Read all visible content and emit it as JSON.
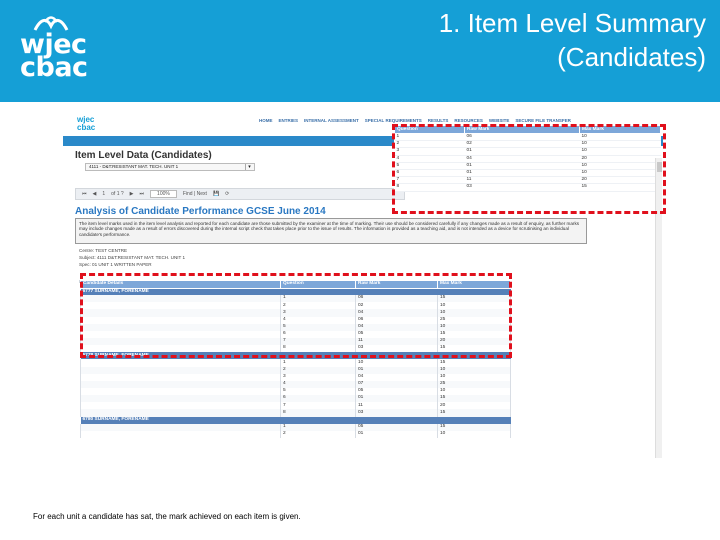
{
  "slide": {
    "title_line1": "1. Item Level Summary",
    "title_line2": "(Candidates)",
    "logo_line1": "wjec",
    "logo_line2": "cbac",
    "caption": "For each unit a candidate has sat, the mark achieved on each item is given."
  },
  "colors": {
    "header": "#159fd6",
    "table_header": "#7da7d9",
    "candidate_row": "#5580b8",
    "highlight": "#e0101c",
    "heading_blue": "#2a78c2"
  },
  "site": {
    "logo_line1": "wjec",
    "logo_line2": "cbac",
    "nav": [
      "HOME",
      "ENTRIES",
      "INTERNAL ASSESSMENT",
      "SPECIAL REQUIREMENTS",
      "RESULTS",
      "RESOURCES",
      "WEBSITE",
      "SECURE FILE TRANSFER"
    ],
    "page_heading": "Item Level Data (Candidates)",
    "unit_select": "4111 - D&T:RESISTANT MAT. TECH. UNIT 1",
    "toolbar": {
      "page": "1",
      "of_pages": "of 1 ?",
      "zoom": "100%",
      "find": "Find | Next"
    },
    "analysis_title": "Analysis of Candidate Performance GCSE June 2014",
    "info_text": "The item level marks used in the item level analysis and reported for each candidate are those submitted by the examiner at the time of marking. Their use should be considered carefully if any changes made as a result of enquiry, as further marks may include changes made as a result of errors discovered during the internal script check that takes place prior to the issue of results. The information is provided as a teaching aid, and is not intended as a device for scrutinising an individual candidate's performance.",
    "centre": "Centre: TEST CENTRE",
    "subject": "Subject: 4111  D&T:RESISTANT MAT. TECH. UNIT 1",
    "spec": "Spec: 01 UNIT 1 WRITTEN PAPER"
  },
  "item_table": {
    "headers": [
      "Question",
      "Raw Mark",
      "Max Mark"
    ],
    "rows": [
      [
        "1",
        "06",
        "10"
      ],
      [
        "2",
        "02",
        "10"
      ],
      [
        "3",
        "01",
        "10"
      ],
      [
        "4",
        "04",
        "20"
      ],
      [
        "5",
        "01",
        "10"
      ],
      [
        "6",
        "01",
        "10"
      ],
      [
        "7",
        "11",
        "20"
      ],
      [
        "8",
        "03",
        "15"
      ]
    ]
  },
  "candidate_table": {
    "headers": [
      "Candidate Details",
      "Question",
      "Raw Mark",
      "Max Mark"
    ],
    "candidates": [
      {
        "name": "6777 SURNAME, FORENAME",
        "rows": [
          [
            "1",
            "06",
            "15"
          ],
          [
            "2",
            "02",
            "10"
          ],
          [
            "3",
            "04",
            "10"
          ],
          [
            "4",
            "06",
            "25"
          ],
          [
            "5",
            "04",
            "10"
          ],
          [
            "6",
            "05",
            "15"
          ],
          [
            "7",
            "11",
            "20"
          ],
          [
            "8",
            "03",
            "15"
          ]
        ]
      },
      {
        "name": "6778 SURNAME, FORENAME",
        "rows": [
          [
            "1",
            "10",
            "15"
          ],
          [
            "2",
            "01",
            "10"
          ],
          [
            "3",
            "04",
            "10"
          ],
          [
            "4",
            "07",
            "25"
          ],
          [
            "5",
            "05",
            "10"
          ],
          [
            "6",
            "01",
            "15"
          ],
          [
            "7",
            "11",
            "20"
          ],
          [
            "8",
            "03",
            "15"
          ]
        ]
      },
      {
        "name": "6780 SURNAME, FORENAME",
        "rows": [
          [
            "1",
            "05",
            "15"
          ],
          [
            "2",
            "01",
            "10"
          ]
        ]
      }
    ]
  }
}
